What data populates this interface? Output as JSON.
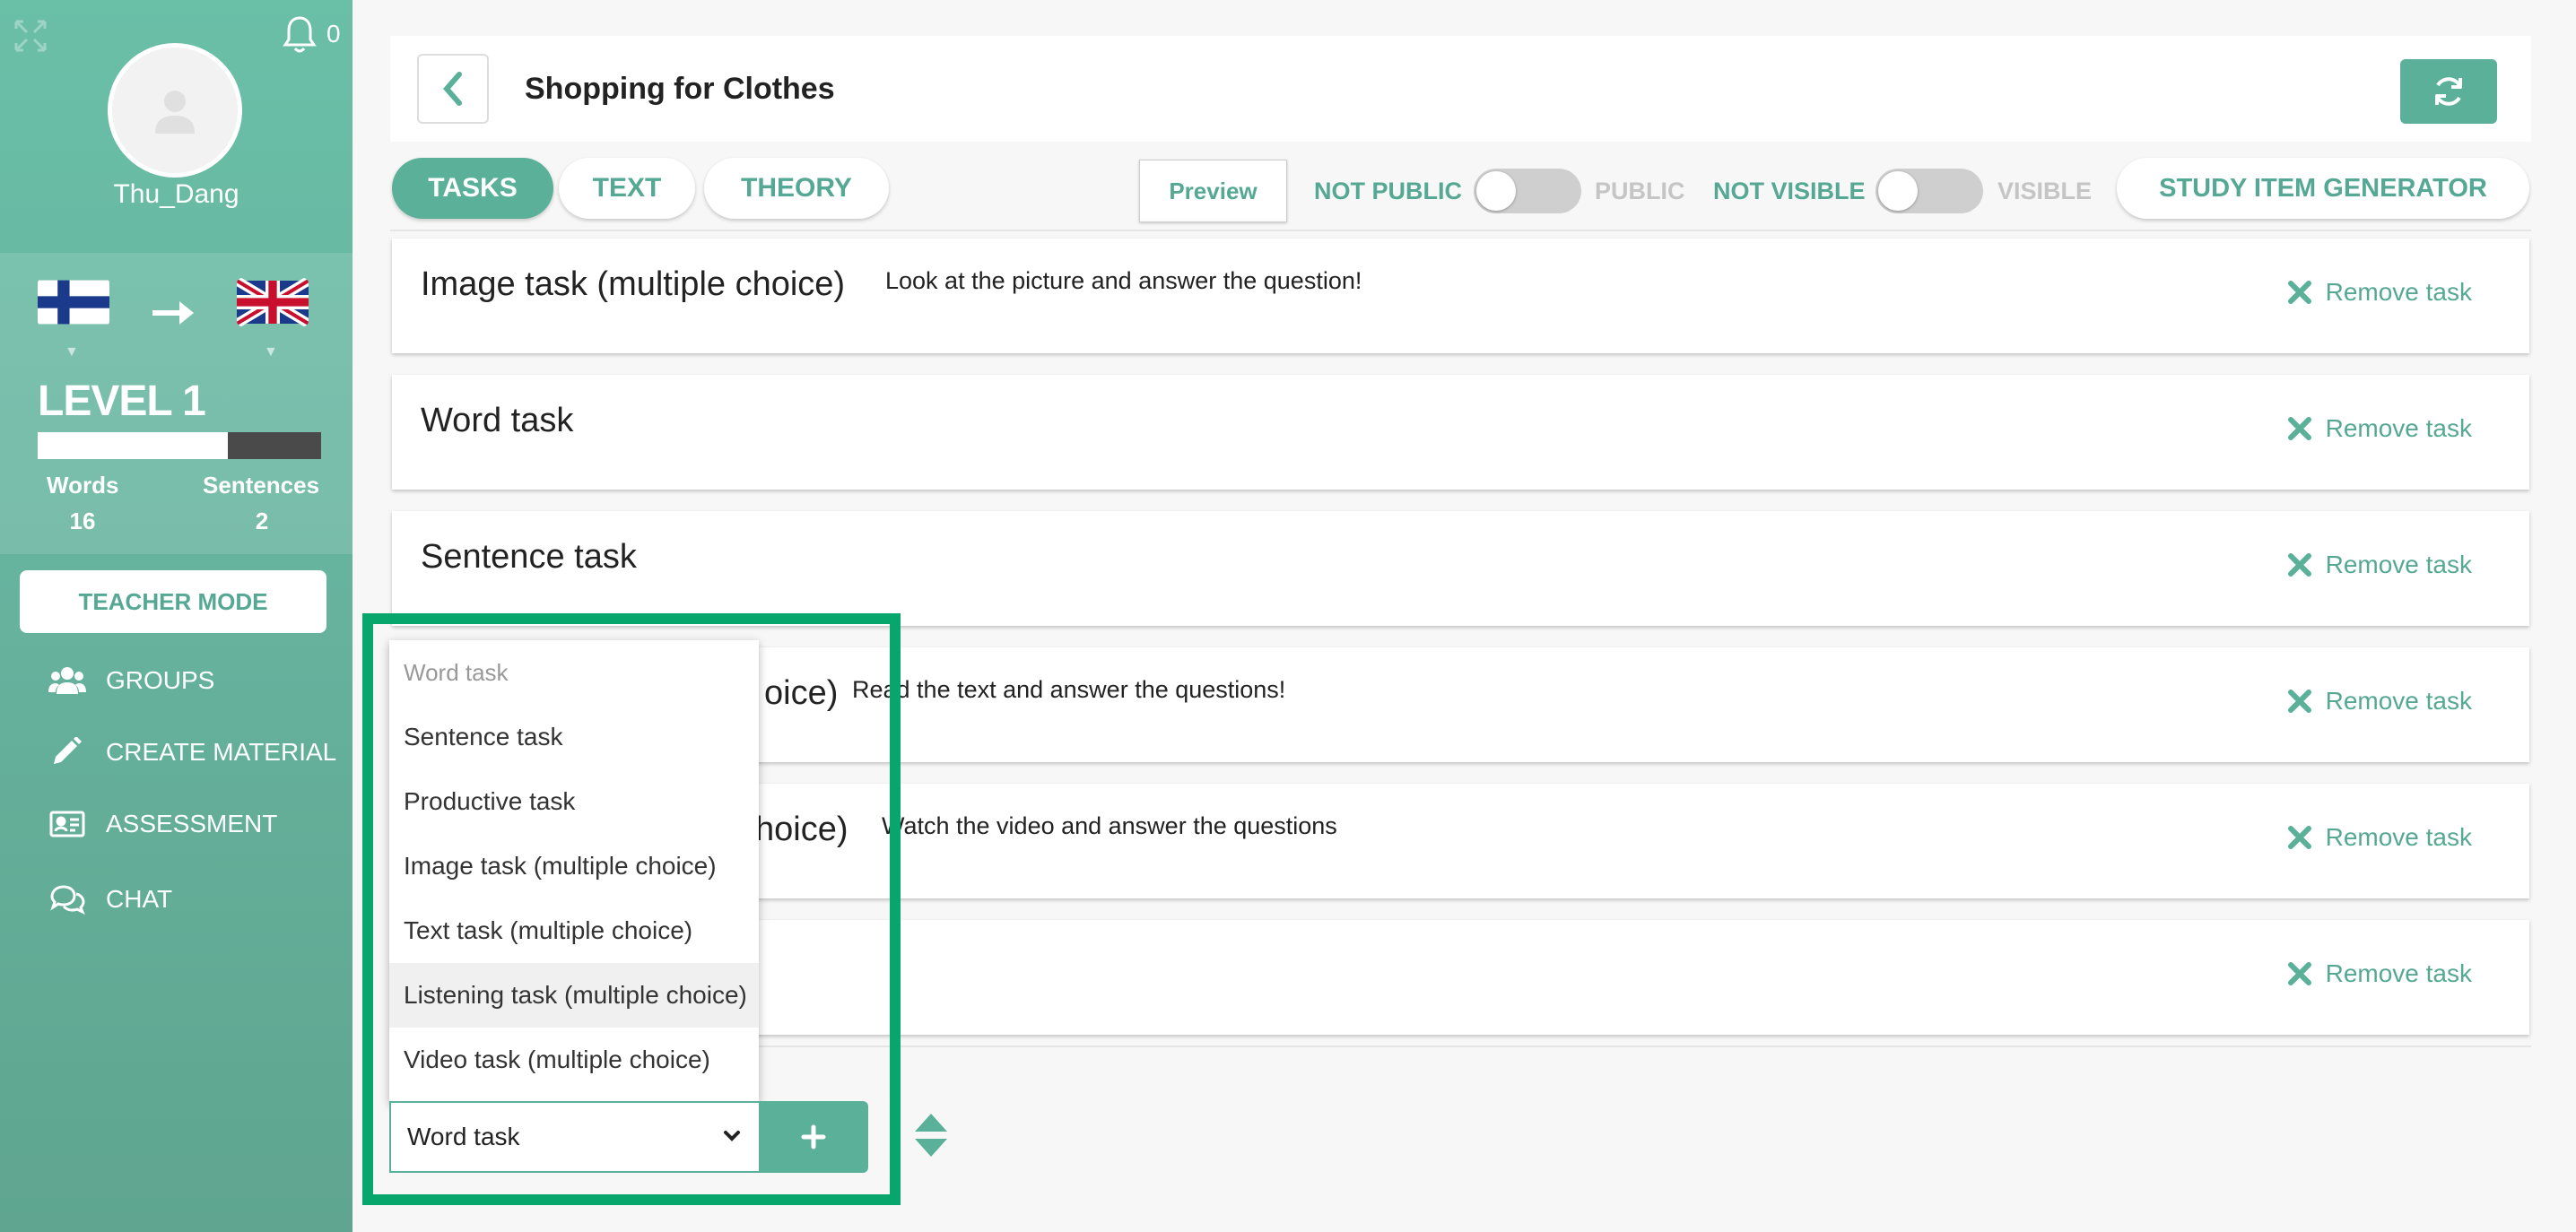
{
  "sidebar": {
    "notification_count": "0",
    "username": "Thu_Dang",
    "level": "LEVEL 1",
    "level_progress": 0.67,
    "words_label": "Words",
    "words_count": "16",
    "sentences_label": "Sentences",
    "sentences_count": "2",
    "teacher_mode": "TEACHER MODE",
    "nav": [
      "GROUPS",
      "CREATE MATERIAL",
      "ASSESSMENT",
      "CHAT"
    ]
  },
  "header": {
    "title": "Shopping for Clothes"
  },
  "tabs": [
    "TASKS",
    "TEXT",
    "THEORY"
  ],
  "toolbar": {
    "preview": "Preview",
    "not_public": "NOT PUBLIC",
    "public": "PUBLIC",
    "not_visible": "NOT VISIBLE",
    "visible": "VISIBLE",
    "generator": "STUDY ITEM GENERATOR"
  },
  "tasks": [
    {
      "title": "Image task (multiple choice)",
      "desc": "Look at the picture and answer the question!"
    },
    {
      "title": "Word task",
      "desc": ""
    },
    {
      "title": "Sentence task",
      "desc": ""
    },
    {
      "title": "oice)",
      "desc": "Read the text and answer the questions!"
    },
    {
      "title": "hoice)",
      "desc": "Watch the video and answer the questions"
    },
    {
      "title": "",
      "desc": ""
    }
  ],
  "remove_label": "Remove task",
  "dropdown": {
    "options": [
      "Word task",
      "Sentence task",
      "Productive task",
      "Image task (multiple choice)",
      "Text task (multiple choice)",
      "Listening task (multiple choice)",
      "Video task (multiple choice)"
    ],
    "selected": "Word task"
  },
  "colors": {
    "accent": "#5ab099",
    "highlight": "#06a66d"
  }
}
